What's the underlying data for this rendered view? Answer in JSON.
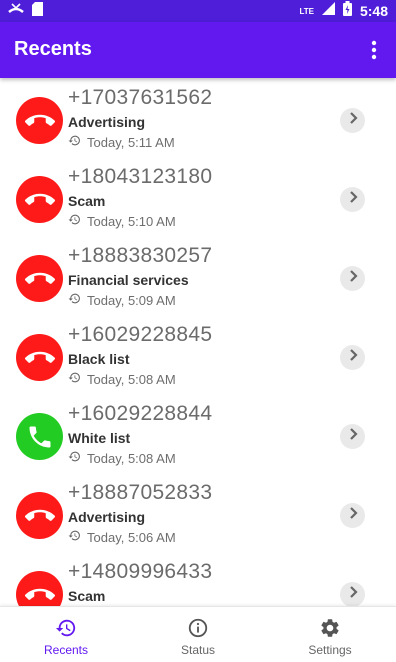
{
  "status_bar": {
    "time": "5:48",
    "network": "LTE"
  },
  "app_bar": {
    "title": "Recents"
  },
  "colors": {
    "accent": "#6219f0",
    "blocked": "#ff1a1a",
    "allowed": "#22cc22"
  },
  "calls": [
    {
      "number": "+17037631562",
      "category": "Advertising",
      "time": "Today, 5:11 AM",
      "status": "blocked"
    },
    {
      "number": "+18043123180",
      "category": "Scam",
      "time": "Today, 5:10 AM",
      "status": "blocked"
    },
    {
      "number": "+18883830257",
      "category": "Financial services",
      "time": "Today, 5:09 AM",
      "status": "blocked"
    },
    {
      "number": "+16029228845",
      "category": "Black list",
      "time": "Today, 5:08 AM",
      "status": "blocked"
    },
    {
      "number": "+16029228844",
      "category": "White list",
      "time": "Today, 5:08 AM",
      "status": "allowed"
    },
    {
      "number": "+18887052833",
      "category": "Advertising",
      "time": "Today, 5:06 AM",
      "status": "blocked"
    },
    {
      "number": "+14809996433",
      "category": "Scam",
      "time": "",
      "status": "blocked"
    }
  ],
  "bottom_nav": [
    {
      "label": "Recents",
      "icon": "history-icon",
      "active": true
    },
    {
      "label": "Status",
      "icon": "info-icon",
      "active": false
    },
    {
      "label": "Settings",
      "icon": "gear-icon",
      "active": false
    }
  ]
}
